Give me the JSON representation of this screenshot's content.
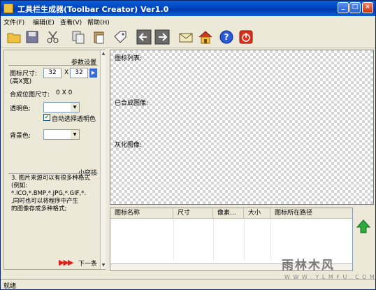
{
  "window": {
    "title": "工具栏生成器(Toolbar Creator) Ver1.0"
  },
  "menu": {
    "items": [
      "文件(F)",
      "编辑(E)",
      "查看(V)",
      "帮助(H)"
    ]
  },
  "left": {
    "section_title": "参数设置",
    "icon_size_label": "图标尺寸:",
    "icon_size_sub": "(高X宽)",
    "height_value": "32",
    "x_sep": "X",
    "width_value": "32",
    "apply_icon": "play-icon",
    "composite_size_label": "合成位图尺寸:",
    "composite_size_value": "0 X 0",
    "transparent_label": "透明色:",
    "auto_transparent_label": "自动选择透明色",
    "background_label": "背景色:",
    "tips_title": "小窍技",
    "tip_text": "3. 图片来源可以有很多种格式(例如:\n*.ICO,*.BMP,*.JPG,*.GIF,*.\n,同时也可以将程序中产生\n的图像存成多种格式;",
    "next_label": "下一条"
  },
  "canvas": {
    "icon_list_label": "图标列表:",
    "composed_label": "已合成图像:",
    "gray_label": "灰化图像:"
  },
  "table": {
    "columns": [
      "图标名称",
      "尺寸",
      "像素...",
      "大小",
      "图标所在路径"
    ]
  },
  "status": {
    "text": "就绪"
  },
  "watermark": {
    "main": "雨林木风",
    "url": "W W W . Y L M F U . C O M"
  },
  "colors": {
    "title_bar": "#0a5fd8",
    "accent_red": "#e0201a",
    "next_arrow": "#e0201a",
    "up_arrow": "#2eaa3c"
  }
}
